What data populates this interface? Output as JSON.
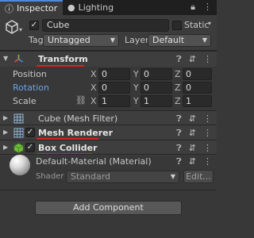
{
  "tabs": {
    "inspector_label": "Inspector",
    "lighting_label": "Lighting"
  },
  "header": {
    "object_name": "Cube",
    "static_label": "Static",
    "tag_label": "Tag",
    "tag_value": "Untagged",
    "layer_label": "Layer",
    "layer_value": "Default"
  },
  "transform": {
    "title": "Transform",
    "rows": [
      {
        "label": "Position",
        "x": "0",
        "y": "0",
        "z": "0"
      },
      {
        "label": "Rotation",
        "x": "0",
        "y": "0",
        "z": "0"
      },
      {
        "label": "Scale",
        "x": "1",
        "y": "1",
        "z": "1"
      }
    ],
    "axis": {
      "x": "X",
      "y": "Y",
      "z": "Z"
    }
  },
  "components": {
    "mesh_filter": "Cube (Mesh Filter)",
    "mesh_renderer": "Mesh Renderer",
    "box_collider": "Box Collider"
  },
  "material": {
    "name": "Default-Material (Material)",
    "shader_label": "Shader",
    "shader_value": "Standard",
    "edit_label": "Edit..."
  },
  "add_component_label": "Add Component",
  "colors": {
    "accent": "#4b8cd8",
    "underline": "#e02020",
    "rotation_label": "#6aa3e8"
  }
}
